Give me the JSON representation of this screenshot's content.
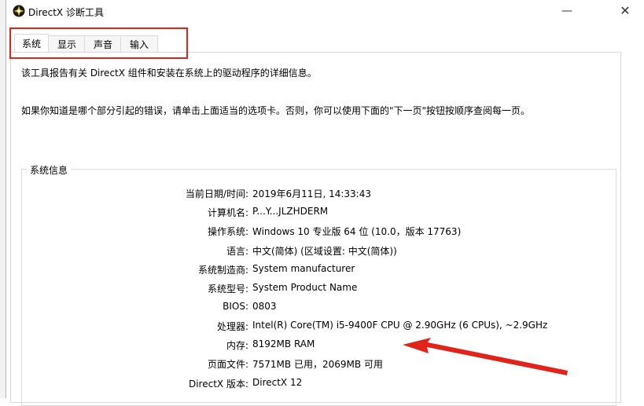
{
  "window": {
    "title": "DirectX 诊断工具",
    "minimize": "—",
    "close": "✕"
  },
  "tabs": [
    "系统",
    "显示",
    "声音",
    "输入"
  ],
  "intro": {
    "line1": "该工具报告有关 DirectX 组件和安装在系统上的驱动程序的详细信息。",
    "line2": "如果你知道是哪个部分引起的错误，请单击上面适当的选项卡。否则，你可以使用下面的\"下一页\"按钮按顺序查阅每一页。"
  },
  "system_info": {
    "group_title": "系统信息",
    "rows": [
      {
        "label": "当前日期/时间:",
        "value": "2019年6月11日, 14:33:43"
      },
      {
        "label": "计算机名:",
        "value": "P...Y...JLZHDERM"
      },
      {
        "label": "操作系统:",
        "value": "Windows 10 专业版 64 位 (10.0，版本 17763)"
      },
      {
        "label": "语言:",
        "value": "中文(简体) (区域设置: 中文(简体))"
      },
      {
        "label": "系统制造商:",
        "value": "System manufacturer"
      },
      {
        "label": "系统型号:",
        "value": "System Product Name"
      },
      {
        "label": "BIOS:",
        "value": "0803"
      },
      {
        "label": "处理器:",
        "value": "Intel(R) Core(TM) i5-9400F CPU @ 2.90GHz (6 CPUs), ~2.9GHz"
      },
      {
        "label": "内存:",
        "value": "8192MB RAM"
      },
      {
        "label": "页面文件:",
        "value": "7571MB 已用，2069MB 可用"
      },
      {
        "label": "DirectX 版本:",
        "value": "DirectX 12"
      }
    ]
  },
  "colors": {
    "highlight_red": "#e2231a",
    "arrow_red": "#e2231a"
  },
  "icons": {
    "app": "directx-icon",
    "minimize": "minimize-icon",
    "close": "close-icon"
  }
}
